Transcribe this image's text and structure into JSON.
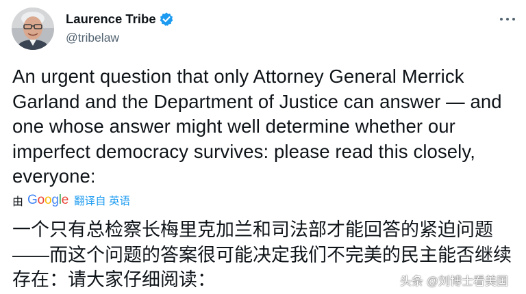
{
  "author": {
    "display_name": "Laurence Tribe",
    "handle": "@tribelaw",
    "verified_icon": "verified-badge-icon",
    "avatar_icon": "avatar-photo"
  },
  "menu": {
    "icon": "more-options-icon"
  },
  "tweet": {
    "text": "An urgent question that only Attorney General Merrick Garland and the Department of Justice can answer — and one whose answer might well determine whether our imperfect democracy survives: please read this closely, everyone:"
  },
  "translation": {
    "by_label": "由",
    "provider": "Google",
    "link_text": "翻译自 英语",
    "text": "一个只有总检察长梅里克加兰和司法部才能回答的紧迫问题——而这个问题的答案很可能决定我们不完美的民主能否继续存在：请大家仔细阅读："
  },
  "watermark": {
    "text": "头条 @刘博士看美国"
  },
  "colors": {
    "accent": "#1d9bf0",
    "text_primary": "#0f1419",
    "text_secondary": "#536471"
  }
}
